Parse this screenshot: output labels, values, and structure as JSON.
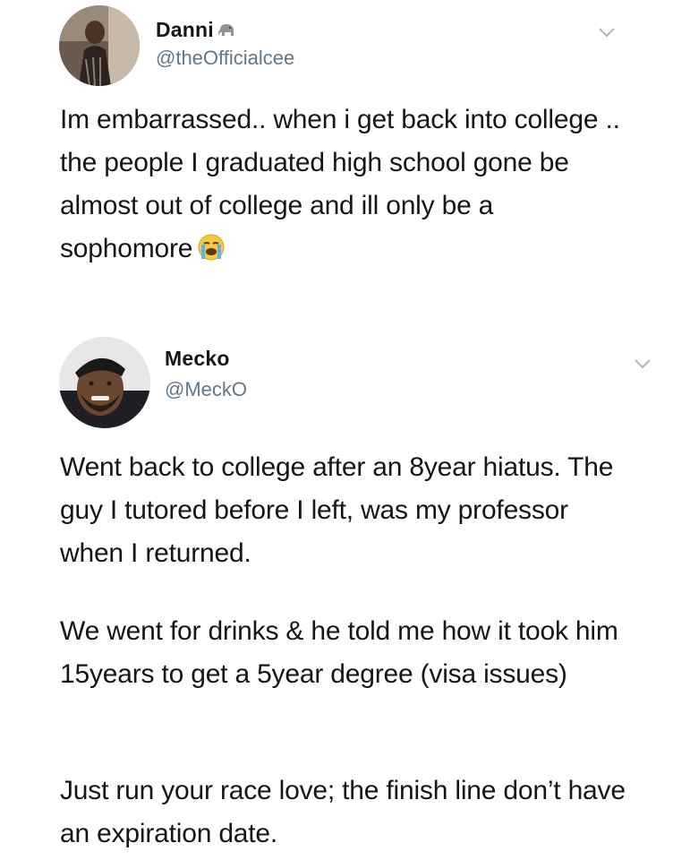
{
  "tweets": [
    {
      "display_name": "Danni",
      "name_emoji": "elephant-emoji",
      "handle": "@theOfficialcee",
      "avatar_icon": "user-avatar-photo",
      "text": "Im embarrassed.. when i get back into college .. the people I graduated high school gone be almost out of college and ill only be a sophomore",
      "text_emoji": "loudly-crying-face-emoji"
    },
    {
      "display_name": "Mecko",
      "handle": "@MeckO",
      "avatar_icon": "user-avatar-photo",
      "paragraphs": [
        "Went back to college after an 8year hiatus. The guy I tutored before I left, was my professor when I returned.",
        "We went for drinks & he told me how it took him 15years to get a 5year degree (visa issues)",
        "Just run your race love; the finish line don’t have an expiration date."
      ]
    }
  ],
  "colors": {
    "text": "#14171a",
    "handle": "#657786",
    "chevron": "#aab8c2",
    "background": "#ffffff"
  }
}
